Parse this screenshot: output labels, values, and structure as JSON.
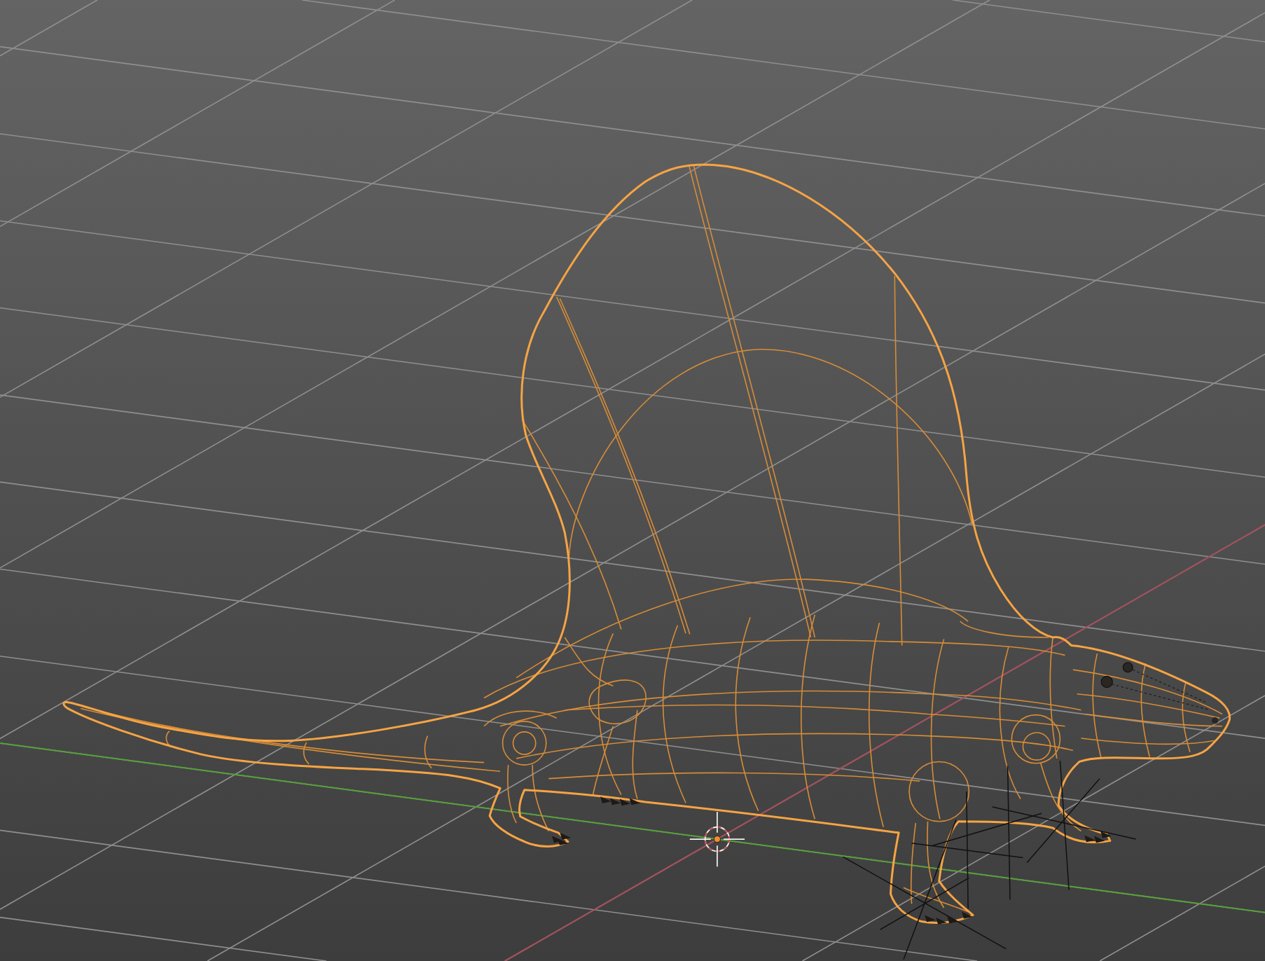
{
  "viewport": {
    "axes": {
      "x": {
        "visible": true
      },
      "y": {
        "visible": true
      }
    },
    "model": {
      "selected": true
    },
    "empties": [
      {
        "selected": false
      },
      {
        "selected": false
      },
      {
        "selected": false
      }
    ]
  }
}
